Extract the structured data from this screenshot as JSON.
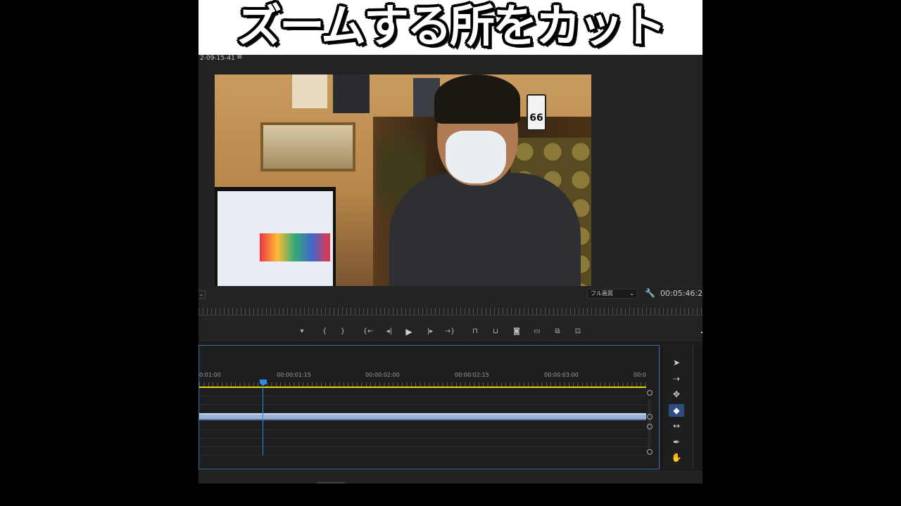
{
  "headline": {
    "text": "ズームする所をカット"
  },
  "monitor": {
    "clip_name": "2-09-15-41",
    "clip_menu_icon": "hamburger-icon",
    "quality": {
      "label": "フル画質",
      "chevron": "⌄"
    },
    "settings_icon": "wrench-icon",
    "timecode": "00:05:46:2",
    "video_sign_text": "66"
  },
  "transport": {
    "buttons": [
      {
        "name": "add-marker",
        "glyph": "▾"
      },
      {
        "name": "mark-in",
        "glyph": "{"
      },
      {
        "name": "mark-out",
        "glyph": "}"
      },
      {
        "name": "go-to-in",
        "glyph": "{←"
      },
      {
        "name": "step-back",
        "glyph": "◂|"
      },
      {
        "name": "play",
        "glyph": "▶"
      },
      {
        "name": "step-forward",
        "glyph": "|▸"
      },
      {
        "name": "go-to-out",
        "glyph": "→}"
      },
      {
        "name": "lift",
        "glyph": "⊓"
      },
      {
        "name": "extract",
        "glyph": "⊔"
      },
      {
        "name": "export-frame",
        "glyph": "◙"
      },
      {
        "name": "comparison-view",
        "glyph": "▭"
      },
      {
        "name": "multi-camera",
        "glyph": "⧉"
      },
      {
        "name": "trim-mode",
        "glyph": "⊡"
      }
    ]
  },
  "timeline": {
    "ticks": [
      "0:01:00",
      "00:00:01:15",
      "00:00:02:00",
      "00:00:02:15",
      "00:00:03:00",
      "00:0"
    ]
  },
  "tools": [
    {
      "name": "selection-tool",
      "glyph": "➤",
      "active": false
    },
    {
      "name": "track-select-tool",
      "glyph": "⇢",
      "active": false
    },
    {
      "name": "ripple-edit-tool",
      "glyph": "✥",
      "active": false
    },
    {
      "name": "razor-tool",
      "glyph": "◆",
      "active": true
    },
    {
      "name": "slip-tool",
      "glyph": "↔",
      "active": false
    },
    {
      "name": "pen-tool",
      "glyph": "✒",
      "active": false
    },
    {
      "name": "hand-tool",
      "glyph": "✋",
      "active": false
    }
  ]
}
